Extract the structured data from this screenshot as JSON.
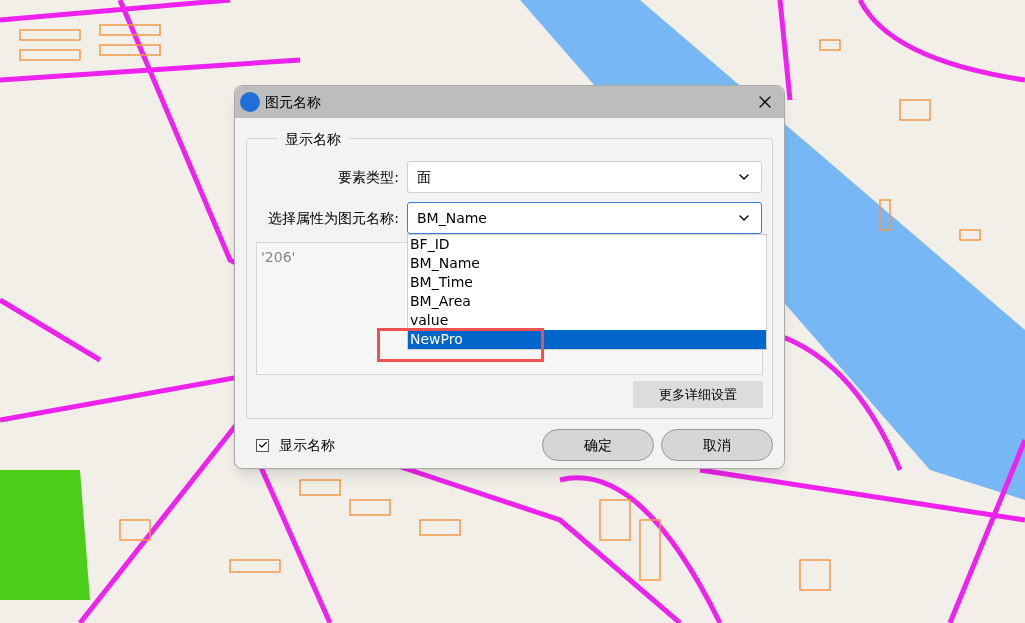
{
  "dialog": {
    "title": "图元名称",
    "group_label": "显示名称",
    "fields": [
      {
        "label": "要素类型:",
        "value": "面",
        "focused": false
      },
      {
        "label": "选择属性为图元名称:",
        "value": "BM_Name",
        "focused": true
      }
    ],
    "dropdown_options": [
      {
        "label": "BF_ID",
        "selected": false
      },
      {
        "label": "BM_Name",
        "selected": false
      },
      {
        "label": "BM_Time",
        "selected": false
      },
      {
        "label": "BM_Area",
        "selected": false
      },
      {
        "label": "value",
        "selected": false
      },
      {
        "label": "NewPro",
        "selected": true
      }
    ],
    "preview_text": "'206'",
    "more_settings_button": "更多详细设置",
    "show_name_checkbox": {
      "label": "显示名称",
      "checked": true
    },
    "buttons": [
      "确定",
      "取消"
    ]
  }
}
